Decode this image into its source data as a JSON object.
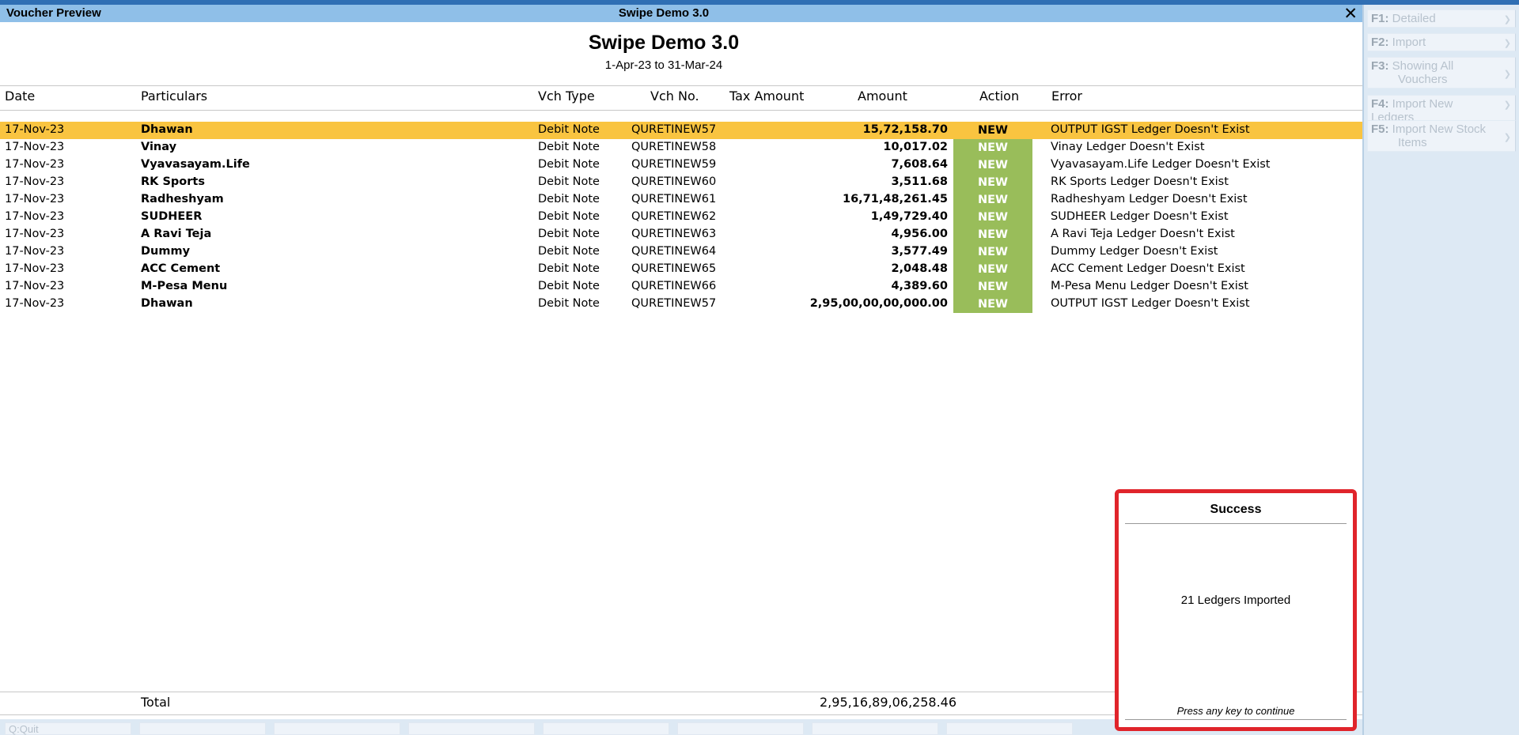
{
  "titlebar": {
    "left": "Voucher Preview",
    "center": "Swipe Demo 3.0",
    "close": "✕"
  },
  "report": {
    "company": "Swipe Demo 3.0",
    "period": "1-Apr-23 to 31-Mar-24"
  },
  "columns": {
    "date": "Date",
    "particulars": "Particulars",
    "vch_type": "Vch Type",
    "vch_no": "Vch No.",
    "tax_amount": "Tax Amount",
    "amount": "Amount",
    "action": "Action",
    "error": "Error"
  },
  "rows": [
    {
      "date": "17-Nov-23",
      "particulars": "Dhawan",
      "vch_type": "Debit Note",
      "vch_no": "QURETINEW57",
      "amount": "15,72,158.70",
      "action": "NEW",
      "error": "OUTPUT IGST Ledger Doesn't Exist"
    },
    {
      "date": "17-Nov-23",
      "particulars": "Vinay",
      "vch_type": "Debit Note",
      "vch_no": "QURETINEW58",
      "amount": "10,017.02",
      "action": "NEW",
      "error": "Vinay Ledger Doesn't Exist"
    },
    {
      "date": "17-Nov-23",
      "particulars": "Vyavasayam.Life",
      "vch_type": "Debit Note",
      "vch_no": "QURETINEW59",
      "amount": "7,608.64",
      "action": "NEW",
      "error": "Vyavasayam.Life Ledger Doesn't Exist"
    },
    {
      "date": "17-Nov-23",
      "particulars": "RK Sports",
      "vch_type": "Debit Note",
      "vch_no": "QURETINEW60",
      "amount": "3,511.68",
      "action": "NEW",
      "error": "RK Sports Ledger Doesn't Exist"
    },
    {
      "date": "17-Nov-23",
      "particulars": "Radheshyam",
      "vch_type": "Debit Note",
      "vch_no": "QURETINEW61",
      "amount": "16,71,48,261.45",
      "action": "NEW",
      "error": "Radheshyam Ledger Doesn't Exist"
    },
    {
      "date": "17-Nov-23",
      "particulars": "SUDHEER",
      "vch_type": "Debit Note",
      "vch_no": "QURETINEW62",
      "amount": "1,49,729.40",
      "action": "NEW",
      "error": "SUDHEER  Ledger Doesn't Exist"
    },
    {
      "date": "17-Nov-23",
      "particulars": "A Ravi Teja",
      "vch_type": "Debit Note",
      "vch_no": "QURETINEW63",
      "amount": "4,956.00",
      "action": "NEW",
      "error": "A Ravi Teja Ledger Doesn't Exist"
    },
    {
      "date": "17-Nov-23",
      "particulars": "Dummy",
      "vch_type": "Debit Note",
      "vch_no": "QURETINEW64",
      "amount": "3,577.49",
      "action": "NEW",
      "error": "Dummy Ledger Doesn't Exist"
    },
    {
      "date": "17-Nov-23",
      "particulars": "ACC Cement",
      "vch_type": "Debit Note",
      "vch_no": "QURETINEW65",
      "amount": "2,048.48",
      "action": "NEW",
      "error": "ACC Cement Ledger Doesn't Exist"
    },
    {
      "date": "17-Nov-23",
      "particulars": "M-Pesa Menu",
      "vch_type": "Debit Note",
      "vch_no": "QURETINEW66",
      "amount": "4,389.60",
      "action": "NEW",
      "error": "M-Pesa Menu Ledger Doesn't Exist"
    },
    {
      "date": "17-Nov-23",
      "particulars": "Dhawan",
      "vch_type": "Debit Note",
      "vch_no": "QURETINEW57",
      "amount": "2,95,00,00,00,000.00",
      "action": "NEW",
      "error": "OUTPUT IGST Ledger Doesn't Exist"
    }
  ],
  "totals": {
    "label": "Total",
    "amount": "2,95,16,89,06,258.46"
  },
  "sidebar": [
    {
      "key": "F1:",
      "label": "Detailed"
    },
    {
      "key": "F2:",
      "label": "Import"
    },
    {
      "key": "F3:",
      "label": "Showing All",
      "label2": "Vouchers"
    },
    {
      "key": "F4:",
      "label": "Import New Ledgers"
    },
    {
      "key": "F5:",
      "label": "Import New Stock",
      "label2": "Items"
    }
  ],
  "bottombar": {
    "quit_key": "Q:",
    "quit_label": "Quit"
  },
  "dialog": {
    "title": "Success",
    "message": "21 Ledgers Imported",
    "footer": "Press any key to continue"
  }
}
